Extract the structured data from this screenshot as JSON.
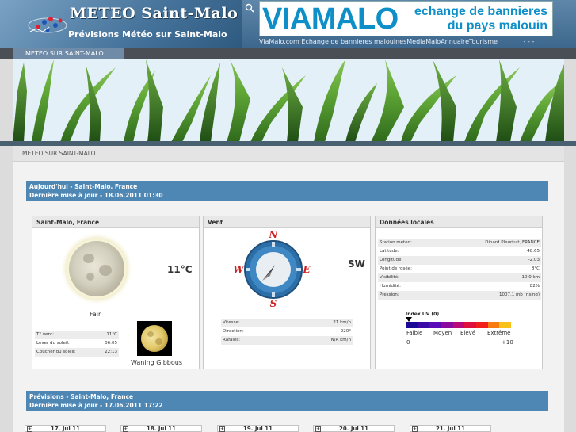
{
  "header": {
    "title": "METEO Saint-Malo",
    "subtitle": "Prévisions Météo sur Saint-Malo",
    "search_icon": "search-icon"
  },
  "banner": {
    "main": "VIAMALO",
    "line1": "echange de bannieres",
    "line2": "du pays malouin"
  },
  "top_links": [
    "ViaMalo.com",
    "Echange de bannieres malouines",
    "MediaMalo",
    "Annuaire",
    "Tourisme"
  ],
  "top_links_trailing": "- - -",
  "nav": {
    "tab": "METEO SUR SAINT-MALO"
  },
  "section_title": "METEO SUR SAINT-MALO",
  "today": {
    "line1": "Aujourd'hui - Saint-Malo, France",
    "line2": "Dernière mise à jour - 18.06.2011 01:30"
  },
  "panel_weather": {
    "title": "Saint-Malo, France",
    "temperature": "11°C",
    "condition": "Fair",
    "rows": [
      {
        "k": "T° vent:",
        "v": "11°C"
      },
      {
        "k": "Lever du soleil:",
        "v": "06:05"
      },
      {
        "k": "Coucher du soleil:",
        "v": "22:13"
      }
    ],
    "moon_phase": "Waning Gibbous"
  },
  "panel_wind": {
    "title": "Vent",
    "direction": "SW",
    "compass_labels": {
      "n": "N",
      "e": "E",
      "s": "S",
      "w": "W"
    },
    "rows": [
      {
        "k": "Vitesse:",
        "v": "21 km/h"
      },
      {
        "k": "Direction:",
        "v": "220°"
      },
      {
        "k": "Rafales:",
        "v": "N/A km/h"
      }
    ]
  },
  "panel_local": {
    "title": "Données locales",
    "rows": [
      {
        "k": "Station meteo:",
        "v": "Dinard Pleurtuit, FRANCE"
      },
      {
        "k": "Latitude:",
        "v": "48.65"
      },
      {
        "k": "Longitude:",
        "v": "-2.03"
      },
      {
        "k": "Point de rosée:",
        "v": "8°C"
      },
      {
        "k": "Visibilité:",
        "v": "10.0 km"
      },
      {
        "k": "Humidité:",
        "v": "82%"
      },
      {
        "k": "Pression:",
        "v": "1007.1 mb (rising)"
      }
    ],
    "uv": {
      "label": "Index UV (0)",
      "value": 0,
      "levels": [
        "Faible",
        "Moyen",
        "Elevé",
        "Extrême"
      ],
      "min": "0",
      "max": "+10",
      "colors": [
        "#1a0a96",
        "#3a0aa8",
        "#5a0ab8",
        "#8a0aa0",
        "#b80a78",
        "#e0103c",
        "#f2201a",
        "#f87a12",
        "#f8c21a"
      ]
    }
  },
  "forecast": {
    "line1": "Prévisions - Saint-Malo, France",
    "line2": "Dernière mise à jour - 17.06.2011 17:22",
    "days": [
      "17. Jul 11",
      "18. Jul 11",
      "19. Jul 11",
      "20. Jul 11",
      "21. Jul 11"
    ]
  }
}
